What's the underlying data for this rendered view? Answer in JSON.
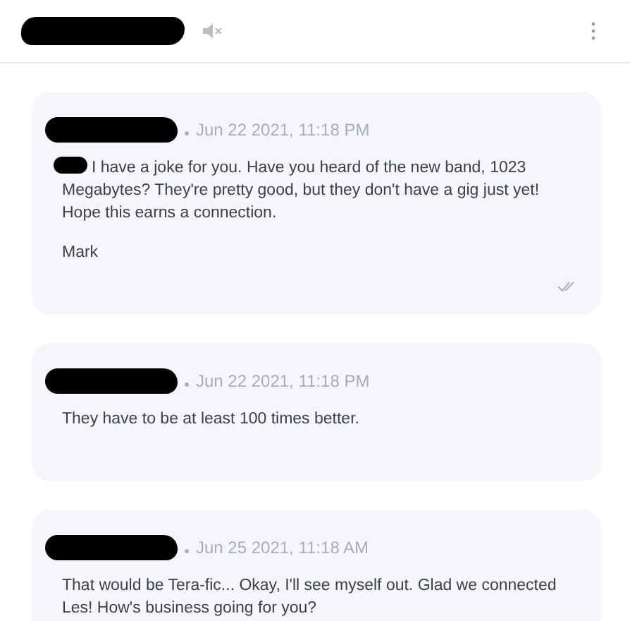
{
  "header": {
    "contact_redacted": true,
    "muted": true
  },
  "messages": [
    {
      "sender_redacted": true,
      "date": "Jun 22 2021, 11:18 PM",
      "read": true,
      "paragraphs": [
        {
          "text": "I have a joke for you. Have you heard of the new band, 1023 Megabytes? They're pretty good, but they don't have a gig just yet! Hope this earns a connection.",
          "redacted_prefix": true
        },
        {
          "text": "Mark",
          "redacted_prefix": false
        }
      ]
    },
    {
      "sender_redacted": true,
      "date": "Jun 22 2021, 11:18 PM",
      "read": false,
      "paragraphs": [
        {
          "text": "They have to be at least 100 times better.",
          "redacted_prefix": false
        }
      ]
    },
    {
      "sender_redacted": true,
      "date": "Jun 25 2021, 11:18 AM",
      "read": false,
      "paragraphs": [
        {
          "text": "That would be Tera-fic... Okay, I'll see myself out. Glad we connected Les! How's business going for you?",
          "redacted_prefix": false
        }
      ]
    }
  ]
}
